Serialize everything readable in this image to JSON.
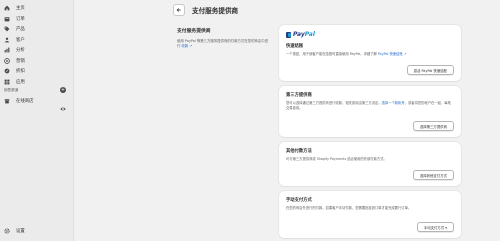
{
  "sidebar": {
    "items": [
      {
        "label": "主页",
        "icon": "home-icon"
      },
      {
        "label": "订单",
        "icon": "orders-icon"
      },
      {
        "label": "产品",
        "icon": "tag-icon"
      },
      {
        "label": "客户",
        "icon": "person-icon"
      },
      {
        "label": "分析",
        "icon": "chart-icon"
      },
      {
        "label": "营销",
        "icon": "target-icon"
      },
      {
        "label": "折扣",
        "icon": "discount-icon"
      },
      {
        "label": "应用",
        "icon": "apps-icon"
      }
    ],
    "section_label": "销售渠道",
    "store_label": "在线商店",
    "settings_label": "设置"
  },
  "header": {
    "title": "支付服务提供商"
  },
  "intro": {
    "title": "支付服务提供商",
    "text": "使用 PayPal 等第三方服务提供商的付款方式在您的商店中进行",
    "link": "收款 ↗"
  },
  "cards": {
    "paypal": {
      "logo_pay": "Pay",
      "logo_pal": "Pal",
      "title": "快速结账",
      "text": "一个按钮，用于使客户能在结账时直接使用 PayPal。详细了解",
      "link": "PayPal 快速结账 ↗",
      "button": "激活 PayPal 快速结账"
    },
    "third_party": {
      "title": "第三方提供商",
      "text": "您可以选择通过第三方提供商进行收款，相关费用由第三方设定。",
      "link": "选择一个新帐号",
      "text2": "，或者将您的帐户在一起，每笔交易费用。",
      "button": "选择第三方提供商"
    },
    "other": {
      "title": "其他付款方法",
      "text": "可与第三方提供商或 Shopify Payments 结合使用的外部付款方式。",
      "button": "选择其他支付方式"
    },
    "manual": {
      "title": "手动支付方式",
      "text": "在您的商店外进行的付款。如果客户手动付款，您需要批准其订单才能完成履行订单。",
      "button": "手动支付方式 ▾"
    }
  },
  "colors": {
    "link": "#2c6ecb",
    "paypal_dark": "#253b80",
    "paypal_light": "#179bd7"
  }
}
